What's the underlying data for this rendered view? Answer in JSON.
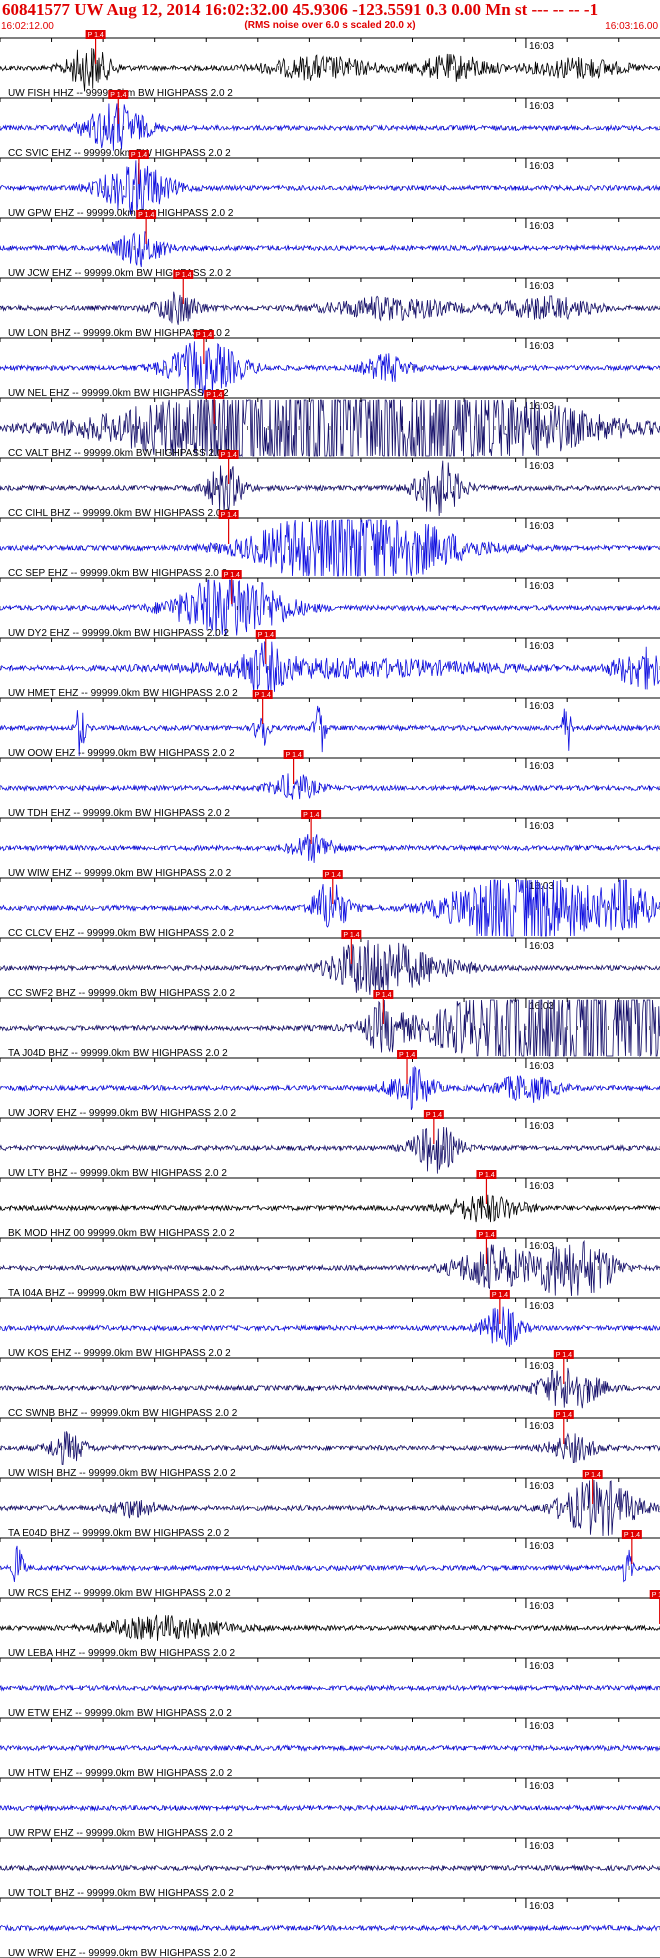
{
  "header": {
    "title": "60841577 UW Aug 12, 2014 16:02:32.00   45.9306 -123.5591  0.3 0.00 Mn st --- -- --  -1",
    "subtitle": "(RMS noise over 6.0 s scaled 20.0 x)",
    "time_start": "16:02:12.00",
    "time_end": "16:03:16.00"
  },
  "colors": {
    "title": "#e00000",
    "pick": "#e00000",
    "blue": "#1010e0",
    "navy": "#16106a",
    "black": "#000000",
    "grid": "#000000"
  },
  "chart_data": {
    "type": "line",
    "title": "60841577 UW Aug 12, 2014 16:02:32.00   45.9306 -123.5591  0.3 0.00 Mn st --- -- --  -1",
    "x_range": [
      "16:02:12.00",
      "16:03:16.00"
    ],
    "minute_label": "16:03",
    "pick_label": "P 1.4",
    "grid": true,
    "traces": [
      {
        "label": "UW FISH HHZ -- 99999.0km BW  HIGHPASS  2.0  2",
        "color": "black",
        "pick_s": 8.3,
        "events": [
          {
            "t": 8.6,
            "amp": 1.0,
            "w": 1.4
          },
          {
            "t": 31,
            "amp": 0.5,
            "w": 3.5
          },
          {
            "t": 44,
            "amp": 0.55,
            "w": 2.5
          },
          {
            "t": 56,
            "amp": 0.45,
            "w": 3
          }
        ]
      },
      {
        "label": "CC SVIC EHZ -- 99999.0km BW  HIGHPASS  2.0  2",
        "color": "blue",
        "pick_s": 10.5,
        "events": [
          {
            "t": 11.2,
            "amp": 1.1,
            "w": 2.0
          }
        ]
      },
      {
        "label": "UW GPW EHZ -- 99999.0km BW  HIGHPASS  2.0  2",
        "color": "blue",
        "pick_s": 12.5,
        "events": [
          {
            "t": 13.1,
            "amp": 1.2,
            "w": 2.2
          }
        ]
      },
      {
        "label": "UW JCW EHZ -- 99999.0km BW  HIGHPASS  2.0  2",
        "color": "blue",
        "pick_s": 13.2,
        "events": [
          {
            "t": 13.6,
            "amp": 0.8,
            "w": 1.5
          }
        ]
      },
      {
        "label": "UW LON BHZ -- 99999.0km BW  HIGHPASS  2.0  2",
        "color": "navy",
        "pick_s": 16.8,
        "events": [
          {
            "t": 17.2,
            "amp": 0.7,
            "w": 1.5
          },
          {
            "t": 38,
            "amp": 0.5,
            "w": 4
          },
          {
            "t": 53,
            "amp": 0.5,
            "w": 3
          }
        ]
      },
      {
        "label": "UW NEL EHZ -- 99999.0km BW  HIGHPASS  2.0  2",
        "color": "blue",
        "pick_s": 18.8,
        "events": [
          {
            "t": 19.8,
            "amp": 1.2,
            "w": 2.5
          },
          {
            "t": 37.5,
            "amp": 0.6,
            "w": 1.5
          }
        ]
      },
      {
        "label": "CC VALT BHZ -- 99999.0km BW  HIGHPASS  2.0  2",
        "color": "navy",
        "pick_s": 19.8,
        "events": [
          {
            "t": 34,
            "amp": 4.0,
            "w": 12,
            "sat": true
          }
        ]
      },
      {
        "label": "CC CIHL BHZ -- 99999.0km BW  HIGHPASS  2.0  2",
        "color": "navy",
        "pick_s": 21.2,
        "events": [
          {
            "t": 21.8,
            "amp": 1.1,
            "w": 1.2
          },
          {
            "t": 42.5,
            "amp": 1.3,
            "w": 1.5
          }
        ]
      },
      {
        "label": "CC SEP EHZ -- 99999.0km BW  HIGHPASS  2.0  2",
        "color": "blue",
        "pick_s": 21.2,
        "events": [
          {
            "t": 35.5,
            "amp": 1.5,
            "w": 6
          },
          {
            "t": 32,
            "amp": 0.8,
            "w": 5
          }
        ]
      },
      {
        "label": "UW DY2 EHZ -- 99999.0km BW  HIGHPASS  2.0  2",
        "color": "blue",
        "pick_s": 21.5,
        "events": [
          {
            "t": 22.5,
            "amp": 1.6,
            "w": 3.5
          }
        ]
      },
      {
        "label": "UW HMET EHZ -- 99999.0km BW  HIGHPASS  2.0  2",
        "color": "blue",
        "pick_s": 24.8,
        "events": [
          {
            "t": 25.5,
            "amp": 0.9,
            "w": 1.5
          },
          {
            "t": 62.5,
            "amp": 0.9,
            "w": 2
          },
          {
            "t": 33,
            "amp": 0.4,
            "w": 10
          }
        ]
      },
      {
        "label": "UW OOW EHZ -- 99999.0km BW  HIGHPASS  2.0  2",
        "color": "blue",
        "pick_s": 24.5,
        "events": [
          {
            "t": 7.8,
            "amp": 1.3,
            "w": 0.3
          },
          {
            "t": 25.4,
            "amp": 1.2,
            "w": 0.4
          },
          {
            "t": 31,
            "amp": 1.3,
            "w": 0.35
          },
          {
            "t": 55,
            "amp": 1.1,
            "w": 0.35
          }
        ]
      },
      {
        "label": "UW TDH EHZ -- 99999.0km BW  HIGHPASS  2.0  2",
        "color": "blue",
        "pick_s": 27.5,
        "events": [
          {
            "t": 28.5,
            "amp": 0.6,
            "w": 1.5
          }
        ]
      },
      {
        "label": "UW WIW EHZ -- 99999.0km BW  HIGHPASS  2.0  2",
        "color": "blue",
        "pick_s": 29.2,
        "events": [
          {
            "t": 30.5,
            "amp": 0.6,
            "w": 1.5
          }
        ]
      },
      {
        "label": "CC CLCV EHZ -- 99999.0km BW  HIGHPASS  2.0  2",
        "color": "blue",
        "pick_s": 31.3,
        "events": [
          {
            "t": 32,
            "amp": 1.2,
            "w": 1.2
          },
          {
            "t": 51,
            "amp": 2.2,
            "w": 4.5
          },
          {
            "t": 61,
            "amp": 1.2,
            "w": 1.5
          }
        ]
      },
      {
        "label": "CC SWF2 BHZ -- 99999.0km BW  HIGHPASS  2.0  2",
        "color": "navy",
        "pick_s": 33.1,
        "events": [
          {
            "t": 35.8,
            "amp": 1.4,
            "w": 2.5
          },
          {
            "t": 41,
            "amp": 0.5,
            "w": 3
          }
        ]
      },
      {
        "label": "TA J04D BHZ -- 99999.0km BW  HIGHPASS  2.0  2",
        "color": "navy",
        "pick_s": 36.2,
        "events": [
          {
            "t": 37.2,
            "amp": 1.0,
            "w": 1.2
          },
          {
            "t": 57,
            "amp": 4.0,
            "w": 8,
            "sat": true
          }
        ]
      },
      {
        "label": "UW JORV EHZ -- 99999.0km BW  HIGHPASS  2.0  2",
        "color": "blue",
        "pick_s": 38.5,
        "events": [
          {
            "t": 39.8,
            "amp": 0.9,
            "w": 1.5
          },
          {
            "t": 51,
            "amp": 0.6,
            "w": 2
          }
        ]
      },
      {
        "label": "UW LTY BHZ -- 99999.0km BW  HIGHPASS  2.0  2",
        "color": "navy",
        "pick_s": 41.1,
        "events": [
          {
            "t": 42.2,
            "amp": 1.1,
            "w": 1.5
          }
        ]
      },
      {
        "label": "BK MOD HHZ 00 99999.0km BW  HIGHPASS  2.0  2",
        "color": "black",
        "pick_s": 46.2,
        "events": [
          {
            "t": 47,
            "amp": 0.6,
            "w": 2.5
          }
        ]
      },
      {
        "label": "TA I04A BHZ -- 99999.0km BW  HIGHPASS  2.0  2",
        "color": "navy",
        "pick_s": 46.2,
        "events": [
          {
            "t": 47.8,
            "amp": 1.0,
            "w": 2.5
          },
          {
            "t": 54.5,
            "amp": 1.2,
            "w": 2
          },
          {
            "t": 58,
            "amp": 0.8,
            "w": 1.5
          }
        ]
      },
      {
        "label": "UW KOS EHZ -- 99999.0km BW  HIGHPASS  2.0  2",
        "color": "blue",
        "pick_s": 47.5,
        "events": [
          {
            "t": 48.6,
            "amp": 1.0,
            "w": 1.2
          }
        ]
      },
      {
        "label": "CC SWNB BHZ -- 99999.0km BW  HIGHPASS  2.0  2",
        "color": "navy",
        "pick_s": 53.7,
        "events": [
          {
            "t": 55.2,
            "amp": 1.0,
            "w": 2.0
          }
        ]
      },
      {
        "label": "UW WISH BHZ -- 99999.0km BW  HIGHPASS  2.0  2",
        "color": "navy",
        "pick_s": 53.7,
        "events": [
          {
            "t": 6.5,
            "amp": 0.7,
            "w": 1.2
          },
          {
            "t": 55.5,
            "amp": 0.6,
            "w": 1.5
          }
        ]
      },
      {
        "label": "TA E04D BHZ -- 99999.0km BW  HIGHPASS  2.0  2",
        "color": "navy",
        "pick_s": 56.5,
        "events": [
          {
            "t": 58,
            "amp": 1.3,
            "w": 2.5
          },
          {
            "t": 13,
            "amp": 0.4,
            "w": 1.5
          }
        ]
      },
      {
        "label": "UW RCS EHZ -- 99999.0km BW  HIGHPASS  2.0  2",
        "color": "blue",
        "pick_s": 60.3,
        "events": [
          {
            "t": 1.8,
            "amp": 1.3,
            "w": 0.3
          },
          {
            "t": 60.8,
            "amp": 1.0,
            "w": 0.3
          }
        ]
      },
      {
        "label": "UW LEBA HHZ -- 99999.0km BW  HIGHPASS  2.0  2",
        "color": "black",
        "pick_s": 63.0,
        "events": [
          {
            "t": 16,
            "amp": 0.5,
            "w": 4
          }
        ]
      },
      {
        "label": "UW ETW EHZ -- 99999.0km BW  HIGHPASS  2.0  2",
        "color": "blue",
        "pick_s": null,
        "events": []
      },
      {
        "label": "UW HTW EHZ -- 99999.0km BW  HIGHPASS  2.0  2",
        "color": "blue",
        "pick_s": null,
        "events": []
      },
      {
        "label": "UW RPW EHZ -- 99999.0km BW  HIGHPASS  2.0  2",
        "color": "blue",
        "pick_s": null,
        "events": []
      },
      {
        "label": "UW TOLT BHZ -- 99999.0km BW  HIGHPASS  2.0  2",
        "color": "navy",
        "pick_s": null,
        "events": []
      },
      {
        "label": "UW WRW EHZ -- 99999.0km BW  HIGHPASS  2.0  2",
        "color": "blue",
        "pick_s": null,
        "events": []
      }
    ]
  }
}
